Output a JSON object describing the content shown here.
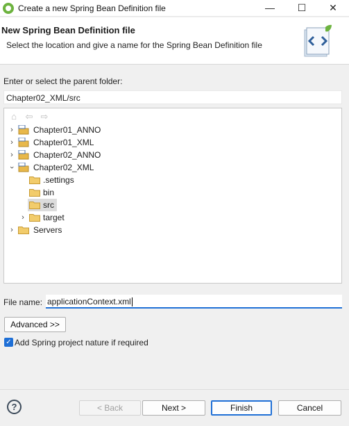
{
  "window": {
    "title": "Create a new Spring Bean Definition file"
  },
  "header": {
    "title": "New Spring Bean Definition file",
    "description": "Select the location and give a name for the Spring Bean Definition file"
  },
  "parent": {
    "label": "Enter or select the parent folder:",
    "value": "Chapter02_XML/src"
  },
  "tree": {
    "items": [
      {
        "label": "Chapter01_ANNO",
        "type": "project",
        "expanded": false
      },
      {
        "label": "Chapter01_XML",
        "type": "project",
        "expanded": false
      },
      {
        "label": "Chapter02_ANNO",
        "type": "project",
        "expanded": false
      },
      {
        "label": "Chapter02_XML",
        "type": "project",
        "expanded": true
      },
      {
        "label": ".settings",
        "type": "folder"
      },
      {
        "label": "bin",
        "type": "folder"
      },
      {
        "label": "src",
        "type": "folder",
        "selected": true
      },
      {
        "label": "target",
        "type": "folder",
        "expanded": false
      },
      {
        "label": "Servers",
        "type": "folder",
        "expanded": false
      }
    ]
  },
  "file": {
    "label": "File name:",
    "value": "applicationContext.xml"
  },
  "buttons": {
    "advanced": "Advanced >>",
    "back": "< Back",
    "next": "Next >",
    "finish": "Finish",
    "cancel": "Cancel"
  },
  "options": {
    "nature_label": "Add Spring project nature if required",
    "nature_checked": true
  },
  "colors": {
    "accent": "#1e6fd6",
    "spring_green": "#6db33f",
    "folder": "#e8b84a"
  }
}
